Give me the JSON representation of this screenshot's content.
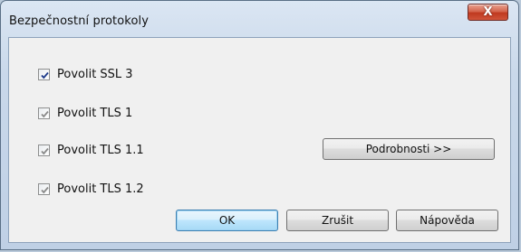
{
  "window": {
    "title": "Bezpečnostní protokoly",
    "close_label": "X"
  },
  "checkboxes": [
    {
      "label": "Povolit SSL 3",
      "checked": true,
      "enabled": true
    },
    {
      "label": "Povolit TLS 1",
      "checked": true,
      "enabled": false
    },
    {
      "label": "Povolit TLS 1.1",
      "checked": true,
      "enabled": false
    },
    {
      "label": "Povolit TLS 1.2",
      "checked": true,
      "enabled": false
    }
  ],
  "buttons": {
    "details": "Podrobnosti >>",
    "ok": "OK",
    "cancel": "Zrušit",
    "help": "Nápověda"
  },
  "colors": {
    "check_enabled": "#1d3a8a",
    "check_disabled": "#8a8a8a"
  }
}
